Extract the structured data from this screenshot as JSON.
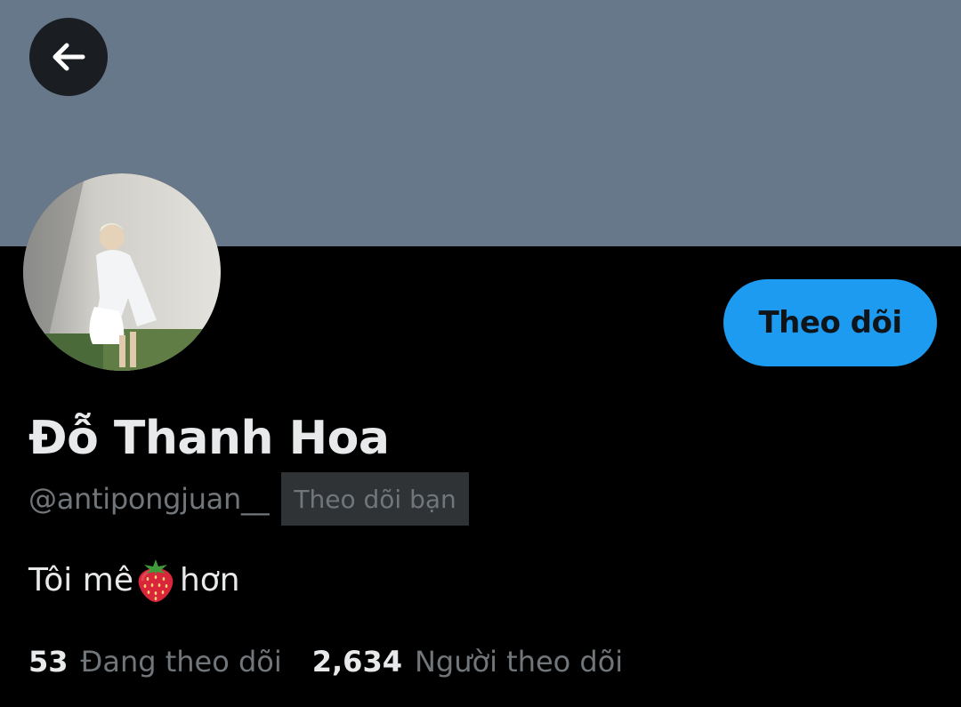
{
  "profile": {
    "display_name": "Đỗ Thanh Hoa",
    "handle": "@antipongjuan__",
    "follows_you_badge": "Theo dõi bạn",
    "bio_before": "Tôi mê",
    "bio_emoji": "strawberry-emoji",
    "bio_after": "hơn",
    "follow_button_label": "Theo dõi"
  },
  "stats": {
    "following_count": "53",
    "following_label": "Đang theo dõi",
    "followers_count": "2,634",
    "followers_label": "Người theo dõi"
  },
  "colors": {
    "banner": "#66788a",
    "background": "#000000",
    "accent": "#1d9bf0",
    "text_primary": "#e7e9ea",
    "text_secondary": "#71767b"
  },
  "icons": {
    "back": "arrow-left-icon"
  }
}
